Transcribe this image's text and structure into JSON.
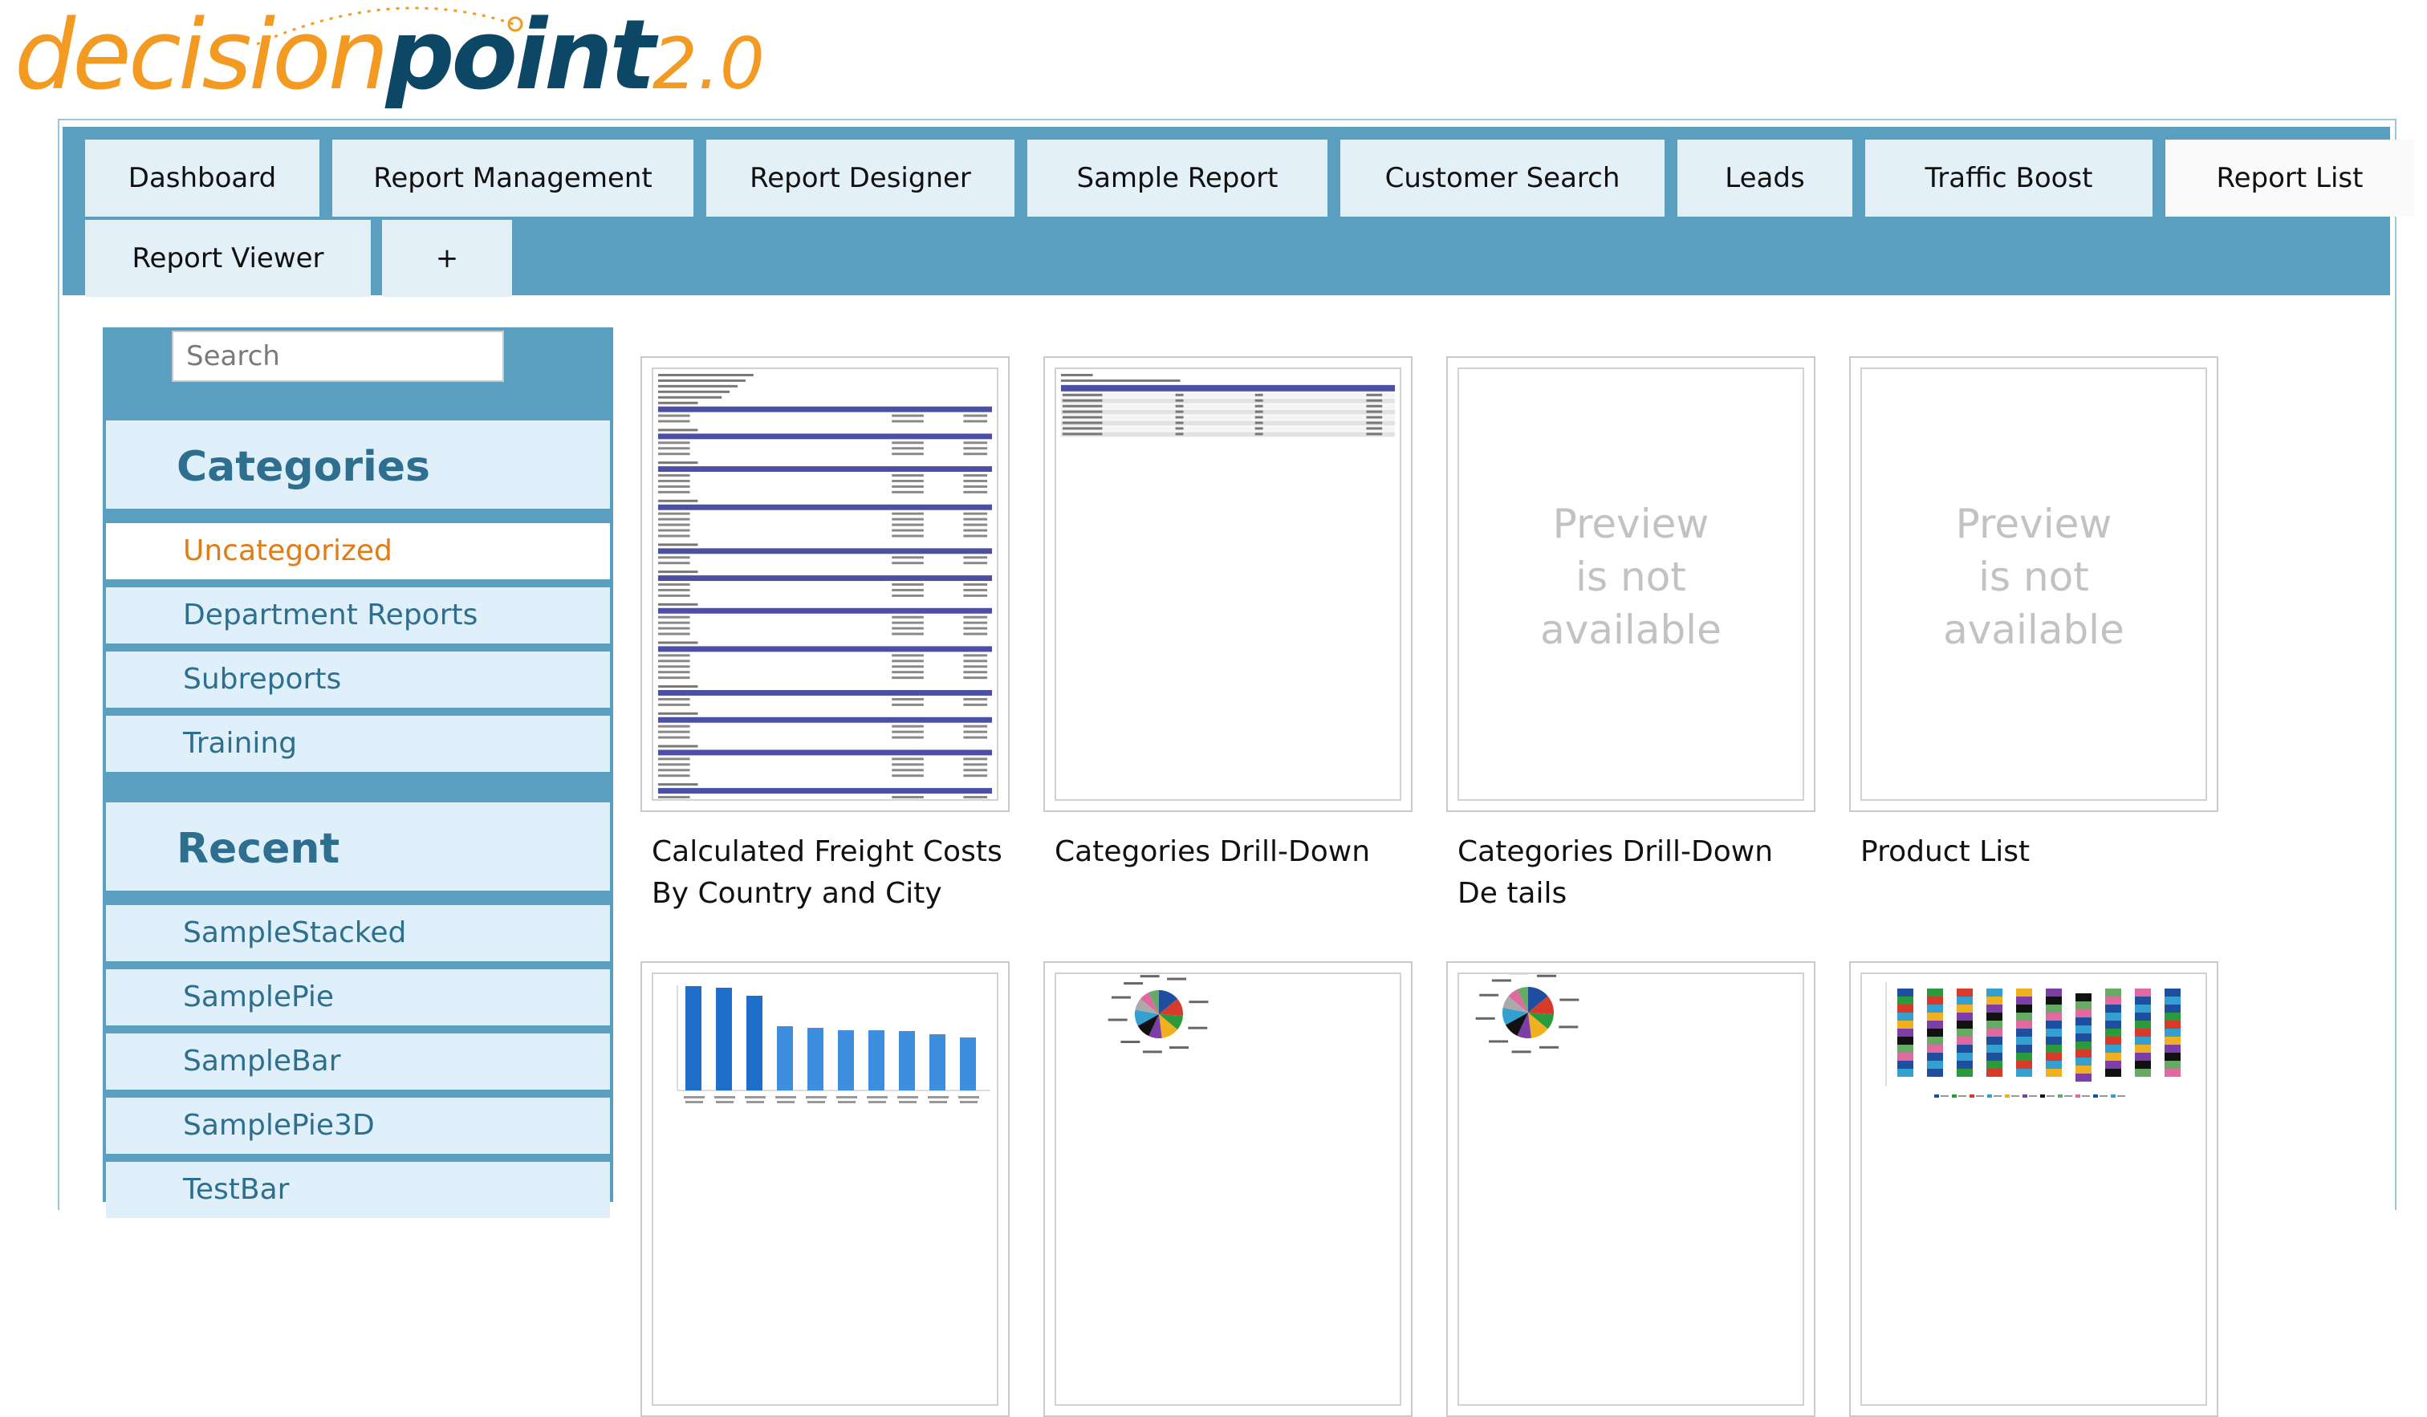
{
  "logo": {
    "part1": "decision",
    "part2": "point",
    "part3": "2.0"
  },
  "tabs": [
    {
      "label": "Dashboard",
      "active": false
    },
    {
      "label": "Report Management",
      "active": false
    },
    {
      "label": "Report Designer",
      "active": false
    },
    {
      "label": "Sample Report",
      "active": false
    },
    {
      "label": "Customer Search",
      "active": false
    },
    {
      "label": "Leads",
      "active": false
    },
    {
      "label": "Traffic Boost",
      "active": false
    },
    {
      "label": "Report List",
      "active": true
    },
    {
      "label": "Report Viewer",
      "active": false
    },
    {
      "label": "+",
      "active": false
    }
  ],
  "sidebar": {
    "search_placeholder": "Search",
    "categories_heading": "Categories",
    "categories": [
      "Uncategorized",
      "Department Reports",
      "Subreports",
      "Training"
    ],
    "selected_category": "Uncategorized",
    "recent_heading": "Recent",
    "recent": [
      "SampleStacked",
      "SamplePie",
      "SampleBar",
      "SamplePie3D",
      "TestBar"
    ]
  },
  "reports": [
    {
      "title": "Calculated Freight Costs By Country and City",
      "preview": "table"
    },
    {
      "title": "Categories Drill-Down",
      "preview": "table-small"
    },
    {
      "title": "Categories Drill-Down De tails",
      "preview": "none"
    },
    {
      "title": "Product List",
      "preview": "none"
    },
    {
      "title": "",
      "preview": "bar"
    },
    {
      "title": "",
      "preview": "pie"
    },
    {
      "title": "",
      "preview": "pie"
    },
    {
      "title": "",
      "preview": "stacked"
    }
  ],
  "preview_unavailable": {
    "line1": "Preview",
    "line2": "is not",
    "line3": "available"
  },
  "colors": {
    "accent_orange": "#f29a22",
    "logo_navy": "#0c4766",
    "tabbar_blue": "#5b9fc0",
    "tab_bg": "#e3f0f8",
    "sidebar_text": "#2e6e8e",
    "selected_text": "#e07b16"
  }
}
